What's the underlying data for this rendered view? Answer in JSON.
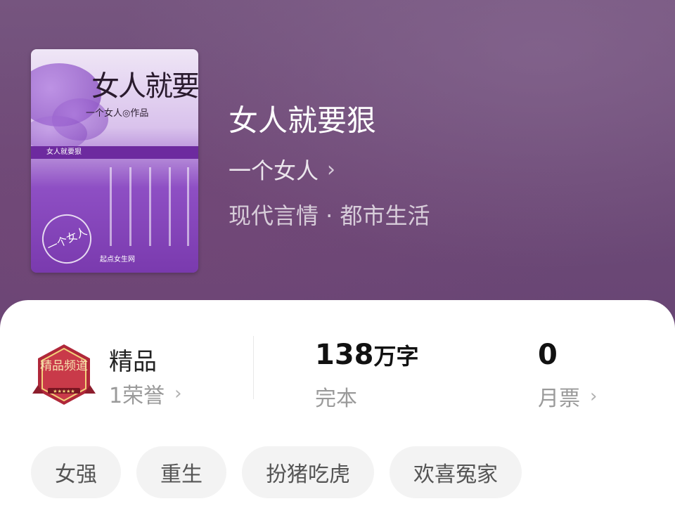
{
  "book": {
    "title": "女人就要狠",
    "author": "一个女人",
    "genre": "现代言情 · 都市生活",
    "cover": {
      "title_art": "女人就要狠",
      "subtitle_art": "一个女人◎作品",
      "banner_text": "女人就要狠",
      "seal_text": "一个女人",
      "publisher_text": "起点女生网"
    }
  },
  "stats": {
    "quality": {
      "label": "精品",
      "sub": "1荣誉",
      "badge_text": "精品频道"
    },
    "words": {
      "value": "138",
      "unit": "万字",
      "sub": "完本"
    },
    "tickets": {
      "value": "0",
      "sub": "月票"
    }
  },
  "tags": [
    "女强",
    "重生",
    "扮猪吃虎",
    "欢喜冤家"
  ],
  "colors": {
    "header_bg": "#6f4a79",
    "sheet_bg": "#ffffff",
    "tag_bg": "#f3f3f3",
    "badge_red": "#b0283a"
  }
}
